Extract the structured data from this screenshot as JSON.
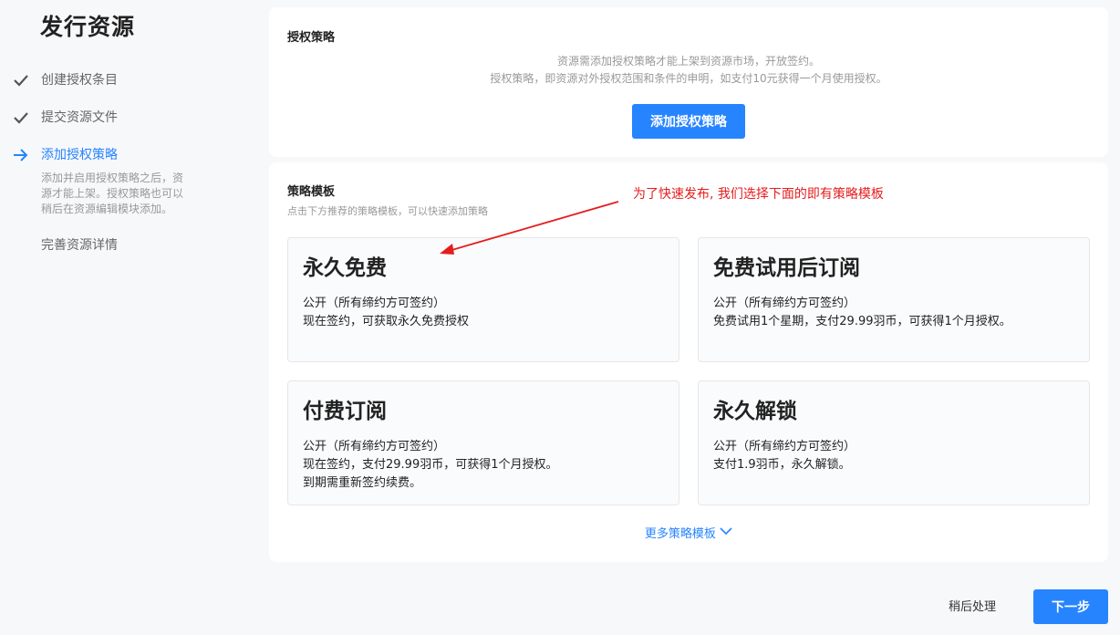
{
  "page": {
    "title": "发行资源"
  },
  "steps": [
    {
      "label": "创建授权条目",
      "status": "done"
    },
    {
      "label": "提交资源文件",
      "status": "done"
    },
    {
      "label": "添加授权策略",
      "status": "active",
      "description": "添加并启用授权策略之后，资源才能上架。授权策略也可以稍后在资源编辑模块添加。"
    },
    {
      "label": "完善资源详情",
      "status": "pending"
    }
  ],
  "auth_panel": {
    "title": "授权策略",
    "hint_line1": "资源需添加授权策略才能上架到资源市场，开放签约。",
    "hint_line2": "授权策略，即资源对外授权范围和条件的申明，如支付10元获得一个月使用授权。",
    "add_button": "添加授权策略"
  },
  "templates_panel": {
    "title": "策略模板",
    "subtitle": "点击下方推荐的策略模板，可以快速添加策略",
    "cards": [
      {
        "title": "永久免费",
        "lines": [
          "公开（所有缔约方可签约）",
          "现在签约，可获取永久免费授权"
        ]
      },
      {
        "title": "免费试用后订阅",
        "lines": [
          "公开（所有缔约方可签约）",
          "免费试用1个星期，支付29.99羽币，可获得1个月授权。"
        ]
      },
      {
        "title": "付费订阅",
        "lines": [
          "公开（所有缔约方可签约）",
          "现在签约，支付29.99羽币，可获得1个月授权。",
          "到期需重新签约续费。"
        ]
      },
      {
        "title": "永久解锁",
        "lines": [
          "公开（所有缔约方可签约）",
          "支付1.9羽币，永久解锁。"
        ]
      }
    ],
    "more_link": "更多策略模板"
  },
  "annotation": {
    "text": "为了快速发布, 我们选择下面的即有策略模板",
    "color": "#e51c1c"
  },
  "footer": {
    "later_button": "稍后处理",
    "next_button": "下一步"
  },
  "colors": {
    "accent": "#2784ff",
    "check": "#555555"
  }
}
